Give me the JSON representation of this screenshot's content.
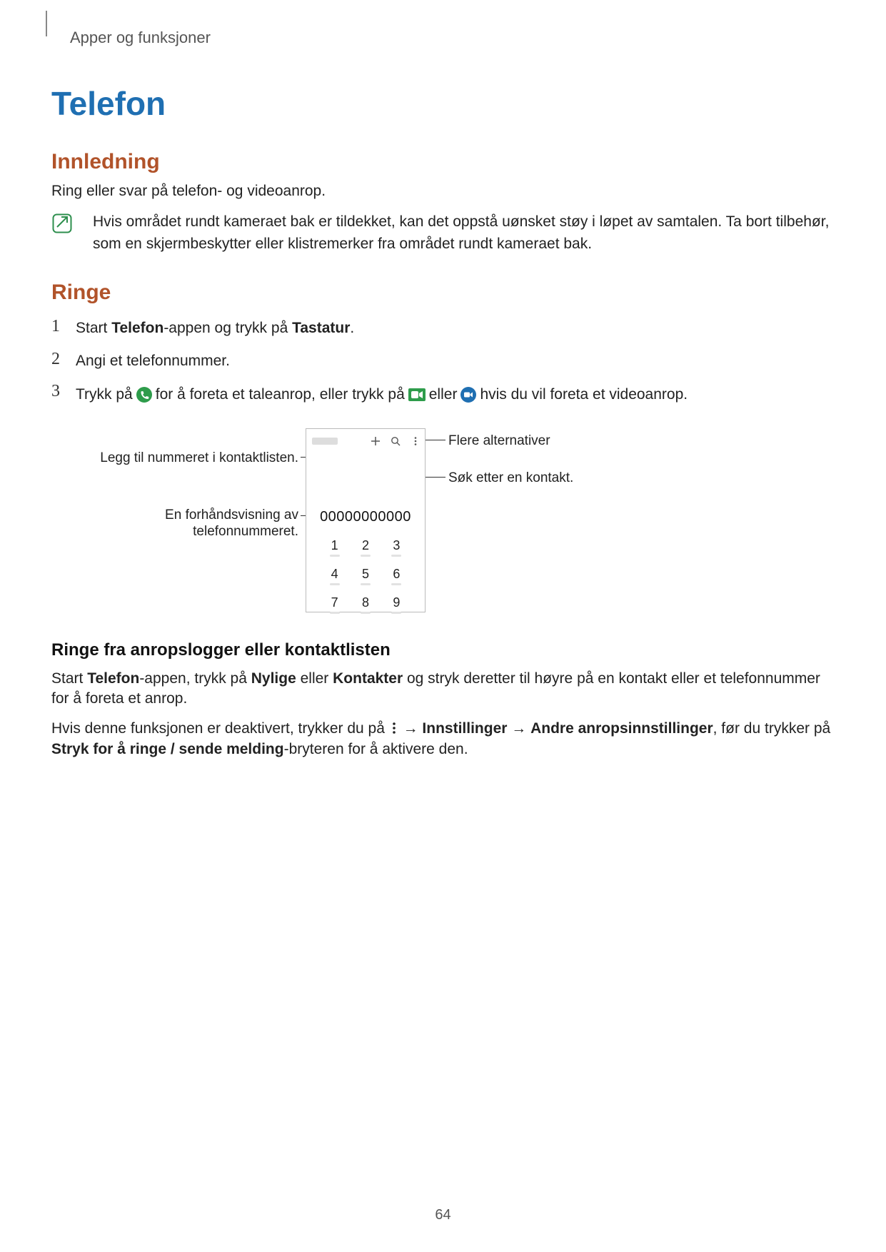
{
  "running_head": "Apper og funksjoner",
  "title": "Telefon",
  "section_intro": "Innledning",
  "intro_text": "Ring eller svar på telefon- og videoanrop.",
  "note_text": "Hvis området rundt kameraet bak er tildekket, kan det oppstå uønsket støy i løpet av samtalen. Ta bort tilbehør, som en skjermbeskytter eller klistremerker fra området rundt kameraet bak.",
  "section_call": "Ringe",
  "steps": {
    "s1_a": "Start ",
    "s1_b": "Telefon",
    "s1_c": "-appen og trykk på ",
    "s1_d": "Tastatur",
    "s1_e": ".",
    "s2": "Angi et telefonnummer.",
    "s3_a": "Trykk på ",
    "s3_b": " for å foreta et taleanrop, eller trykk på ",
    "s3_c": " eller ",
    "s3_d": " hvis du vil foreta et videoanrop."
  },
  "callouts": {
    "add_contact": "Legg til nummeret i kontaktlisten.",
    "preview_a": "En forhåndsvisning av",
    "preview_b": "telefonnummeret.",
    "more_options": "Flere alternativer",
    "search_contact": "Søk etter en kontakt."
  },
  "phone": {
    "number": "00000000000",
    "keys": [
      "1",
      "2",
      "3",
      "4",
      "5",
      "6",
      "7",
      "8",
      "9"
    ]
  },
  "subhead": "Ringe fra anropslogger eller kontaktlisten",
  "para2": {
    "a": "Start ",
    "b": "Telefon",
    "c": "-appen, trykk på ",
    "d": "Nylige",
    "e": " eller ",
    "f": "Kontakter",
    "g": " og stryk deretter til høyre på en kontakt eller et telefonnummer for å foreta et anrop."
  },
  "para3": {
    "a": "Hvis denne funksjonen er deaktivert, trykker du på ",
    "b": " → ",
    "c": "Innstillinger",
    "d": " → ",
    "e": "Andre anropsinnstillinger",
    "f": ", før du trykker på ",
    "g": "Stryk for å ringe / sende melding",
    "h": "-bryteren for å aktivere den."
  },
  "page_number": "64"
}
